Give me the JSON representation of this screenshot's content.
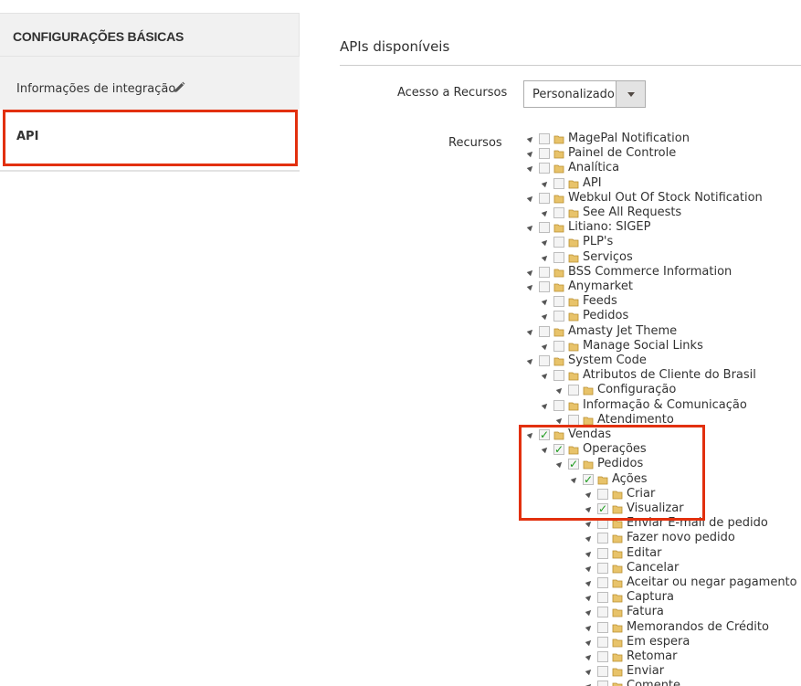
{
  "sidebar": {
    "heading": "CONFIGURAÇÕES BÁSICAS",
    "items": [
      {
        "label": "Informações de integração",
        "icon": "pencil-icon"
      },
      {
        "label": "API",
        "selected": true
      }
    ]
  },
  "main": {
    "section_title": "APIs disponíveis",
    "access_label": "Acesso a Recursos",
    "access_value": "Personalizado",
    "resources_label": "Recursos"
  },
  "tree": [
    {
      "level": 0,
      "label": "MagePal Notification",
      "checked": false
    },
    {
      "level": 0,
      "label": "Painel de Controle",
      "checked": false
    },
    {
      "level": 0,
      "label": "Analítica",
      "checked": false
    },
    {
      "level": 1,
      "label": "API",
      "checked": false
    },
    {
      "level": 0,
      "label": "Webkul Out Of Stock Notification",
      "checked": false
    },
    {
      "level": 1,
      "label": "See All Requests",
      "checked": false
    },
    {
      "level": 0,
      "label": "Litiano: SIGEP",
      "checked": false
    },
    {
      "level": 1,
      "label": "PLP's",
      "checked": false
    },
    {
      "level": 1,
      "label": "Serviços",
      "checked": false
    },
    {
      "level": 0,
      "label": "BSS Commerce Information",
      "checked": false
    },
    {
      "level": 0,
      "label": "Anymarket",
      "checked": false
    },
    {
      "level": 1,
      "label": "Feeds",
      "checked": false
    },
    {
      "level": 1,
      "label": "Pedidos",
      "checked": false
    },
    {
      "level": 0,
      "label": "Amasty Jet Theme",
      "checked": false
    },
    {
      "level": 1,
      "label": "Manage Social Links",
      "checked": false
    },
    {
      "level": 0,
      "label": "System Code",
      "checked": false
    },
    {
      "level": 1,
      "label": "Atributos de Cliente do Brasil",
      "checked": false
    },
    {
      "level": 2,
      "label": "Configuração",
      "checked": false
    },
    {
      "level": 1,
      "label": "Informação & Comunicação",
      "checked": false
    },
    {
      "level": 2,
      "label": "Atendimento",
      "checked": false
    },
    {
      "level": 0,
      "label": "Vendas",
      "checked": true
    },
    {
      "level": 1,
      "label": "Operações",
      "checked": true
    },
    {
      "level": 2,
      "label": "Pedidos",
      "checked": true
    },
    {
      "level": 3,
      "label": "Ações",
      "checked": true
    },
    {
      "level": 4,
      "label": "Criar",
      "checked": false
    },
    {
      "level": 4,
      "label": "Visualizar",
      "checked": true
    },
    {
      "level": 4,
      "label": "Enviar E-mail de pedido",
      "checked": false
    },
    {
      "level": 4,
      "label": "Fazer novo pedido",
      "checked": false
    },
    {
      "level": 4,
      "label": "Editar",
      "checked": false
    },
    {
      "level": 4,
      "label": "Cancelar",
      "checked": false
    },
    {
      "level": 4,
      "label": "Aceitar ou negar pagamento",
      "checked": false
    },
    {
      "level": 4,
      "label": "Captura",
      "checked": false
    },
    {
      "level": 4,
      "label": "Fatura",
      "checked": false
    },
    {
      "level": 4,
      "label": "Memorandos de Crédito",
      "checked": false
    },
    {
      "level": 4,
      "label": "Em espera",
      "checked": false
    },
    {
      "level": 4,
      "label": "Retomar",
      "checked": false
    },
    {
      "level": 4,
      "label": "Enviar",
      "checked": false
    },
    {
      "level": 4,
      "label": "Comente",
      "checked": false
    }
  ],
  "colors": {
    "highlight": "#e2300e",
    "check": "#1a9a1a",
    "folder": "#e8c36a"
  }
}
